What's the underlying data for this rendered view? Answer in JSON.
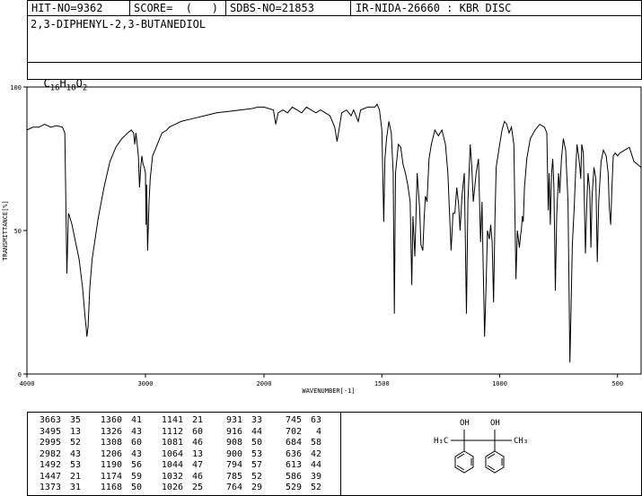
{
  "header": {
    "hit_no": "HIT-NO=9362",
    "score": "SCORE=  (   )",
    "sdbs_no": "SDBS-NO=21853",
    "ir_id": "IR-NIDA-26660 : KBR DISC",
    "compound_name": "2,3-DIPHENYL-2,3-BUTANEDIOL",
    "formula": {
      "c": "C",
      "c_n": "16",
      "h": "H",
      "h_n": "18",
      "o": "O",
      "o_n": "2"
    }
  },
  "chart_data": {
    "type": "line",
    "xlabel": "WAVENUMBER[-1]",
    "ylabel": "TRANSMITTANCE[%]",
    "xlim": [
      4000,
      400
    ],
    "ylim": [
      0,
      100
    ],
    "x_ticks": [
      "4000",
      "3000",
      "2000",
      "1500",
      "1000",
      "500"
    ],
    "y_ticks": [
      "100",
      "50",
      "0"
    ],
    "series": [
      {
        "points": [
          [
            4000,
            85
          ],
          [
            3950,
            86
          ],
          [
            3900,
            86
          ],
          [
            3850,
            87
          ],
          [
            3800,
            86
          ],
          [
            3750,
            86.5
          ],
          [
            3700,
            86
          ],
          [
            3680,
            84
          ],
          [
            3663,
            35
          ],
          [
            3650,
            56
          ],
          [
            3640,
            55
          ],
          [
            3620,
            52
          ],
          [
            3600,
            48
          ],
          [
            3560,
            40
          ],
          [
            3530,
            30
          ],
          [
            3510,
            20
          ],
          [
            3500,
            16
          ],
          [
            3495,
            13
          ],
          [
            3485,
            16
          ],
          [
            3470,
            30
          ],
          [
            3450,
            40
          ],
          [
            3400,
            54
          ],
          [
            3350,
            65
          ],
          [
            3300,
            74
          ],
          [
            3250,
            79
          ],
          [
            3200,
            82
          ],
          [
            3150,
            84
          ],
          [
            3120,
            85
          ],
          [
            3100,
            84
          ],
          [
            3090,
            80
          ],
          [
            3080,
            84
          ],
          [
            3070,
            80
          ],
          [
            3060,
            76
          ],
          [
            3050,
            65
          ],
          [
            3040,
            72
          ],
          [
            3030,
            76
          ],
          [
            3020,
            73
          ],
          [
            3010,
            72
          ],
          [
            3000,
            70
          ],
          [
            2995,
            52
          ],
          [
            2990,
            66
          ],
          [
            2982,
            43
          ],
          [
            2970,
            60
          ],
          [
            2960,
            68
          ],
          [
            2950,
            72
          ],
          [
            2940,
            76
          ],
          [
            2920,
            78
          ],
          [
            2900,
            80
          ],
          [
            2880,
            82
          ],
          [
            2860,
            84
          ],
          [
            2820,
            85
          ],
          [
            2800,
            86
          ],
          [
            2750,
            87
          ],
          [
            2700,
            88
          ],
          [
            2600,
            89
          ],
          [
            2500,
            90
          ],
          [
            2400,
            91
          ],
          [
            2300,
            91.5
          ],
          [
            2200,
            92
          ],
          [
            2100,
            92.5
          ],
          [
            2050,
            93
          ],
          [
            2000,
            93
          ],
          [
            1960,
            92
          ],
          [
            1950,
            87
          ],
          [
            1940,
            91
          ],
          [
            1920,
            92
          ],
          [
            1900,
            91
          ],
          [
            1880,
            93
          ],
          [
            1860,
            92
          ],
          [
            1840,
            91
          ],
          [
            1820,
            93
          ],
          [
            1800,
            92
          ],
          [
            1780,
            91
          ],
          [
            1760,
            92
          ],
          [
            1740,
            91
          ],
          [
            1720,
            90
          ],
          [
            1700,
            86
          ],
          [
            1690,
            81
          ],
          [
            1680,
            86
          ],
          [
            1670,
            91
          ],
          [
            1650,
            92
          ],
          [
            1630,
            90
          ],
          [
            1620,
            92
          ],
          [
            1610,
            90
          ],
          [
            1600,
            88
          ],
          [
            1590,
            92
          ],
          [
            1560,
            93
          ],
          [
            1530,
            93
          ],
          [
            1520,
            94
          ],
          [
            1510,
            92
          ],
          [
            1500,
            85
          ],
          [
            1492,
            53
          ],
          [
            1487,
            75
          ],
          [
            1480,
            82
          ],
          [
            1470,
            88
          ],
          [
            1460,
            84
          ],
          [
            1452,
            70
          ],
          [
            1447,
            21
          ],
          [
            1442,
            70
          ],
          [
            1430,
            80
          ],
          [
            1420,
            79
          ],
          [
            1410,
            73
          ],
          [
            1400,
            70
          ],
          [
            1390,
            66
          ],
          [
            1380,
            60
          ],
          [
            1373,
            31
          ],
          [
            1368,
            55
          ],
          [
            1360,
            41
          ],
          [
            1355,
            55
          ],
          [
            1350,
            70
          ],
          [
            1340,
            58
          ],
          [
            1334,
            45
          ],
          [
            1326,
            43
          ],
          [
            1320,
            55
          ],
          [
            1315,
            62
          ],
          [
            1308,
            60
          ],
          [
            1300,
            75
          ],
          [
            1290,
            80
          ],
          [
            1275,
            85
          ],
          [
            1260,
            83
          ],
          [
            1245,
            85
          ],
          [
            1230,
            80
          ],
          [
            1220,
            70
          ],
          [
            1206,
            43
          ],
          [
            1198,
            56
          ],
          [
            1190,
            56
          ],
          [
            1182,
            65
          ],
          [
            1174,
            59
          ],
          [
            1168,
            50
          ],
          [
            1160,
            62
          ],
          [
            1150,
            70
          ],
          [
            1141,
            21
          ],
          [
            1135,
            60
          ],
          [
            1125,
            80
          ],
          [
            1118,
            72
          ],
          [
            1112,
            60
          ],
          [
            1100,
            70
          ],
          [
            1090,
            75
          ],
          [
            1081,
            46
          ],
          [
            1075,
            60
          ],
          [
            1070,
            38
          ],
          [
            1064,
            13
          ],
          [
            1058,
            30
          ],
          [
            1052,
            50
          ],
          [
            1044,
            47
          ],
          [
            1038,
            52
          ],
          [
            1032,
            46
          ],
          [
            1026,
            25
          ],
          [
            1020,
            55
          ],
          [
            1015,
            72
          ],
          [
            1000,
            80
          ],
          [
            990,
            85
          ],
          [
            980,
            88
          ],
          [
            970,
            87
          ],
          [
            960,
            84
          ],
          [
            950,
            86
          ],
          [
            940,
            80
          ],
          [
            931,
            33
          ],
          [
            925,
            50
          ],
          [
            916,
            44
          ],
          [
            912,
            48
          ],
          [
            908,
            50
          ],
          [
            904,
            55
          ],
          [
            900,
            53
          ],
          [
            895,
            65
          ],
          [
            885,
            75
          ],
          [
            870,
            82
          ],
          [
            850,
            85
          ],
          [
            830,
            87
          ],
          [
            810,
            86
          ],
          [
            800,
            84
          ],
          [
            794,
            57
          ],
          [
            790,
            70
          ],
          [
            785,
            52
          ],
          [
            780,
            70
          ],
          [
            775,
            75
          ],
          [
            770,
            65
          ],
          [
            764,
            29
          ],
          [
            758,
            55
          ],
          [
            750,
            70
          ],
          [
            745,
            63
          ],
          [
            738,
            75
          ],
          [
            730,
            82
          ],
          [
            720,
            78
          ],
          [
            710,
            60
          ],
          [
            702,
            4
          ],
          [
            698,
            20
          ],
          [
            692,
            45
          ],
          [
            684,
            58
          ],
          [
            678,
            70
          ],
          [
            672,
            80
          ],
          [
            665,
            76
          ],
          [
            660,
            72
          ],
          [
            656,
            68
          ],
          [
            652,
            80
          ],
          [
            645,
            77
          ],
          [
            636,
            42
          ],
          [
            630,
            60
          ],
          [
            625,
            70
          ],
          [
            618,
            64
          ],
          [
            613,
            44
          ],
          [
            608,
            62
          ],
          [
            600,
            72
          ],
          [
            592,
            68
          ],
          [
            586,
            39
          ],
          [
            580,
            60
          ],
          [
            570,
            74
          ],
          [
            560,
            78
          ],
          [
            548,
            76
          ],
          [
            540,
            70
          ],
          [
            535,
            58
          ],
          [
            529,
            52
          ],
          [
            524,
            65
          ],
          [
            518,
            76
          ],
          [
            510,
            77
          ],
          [
            500,
            76
          ],
          [
            490,
            77
          ],
          [
            470,
            78
          ],
          [
            450,
            79
          ],
          [
            430,
            74
          ],
          [
            415,
            73
          ],
          [
            400,
            72
          ]
        ]
      }
    ]
  },
  "peak_table": {
    "columns": [
      [
        [
          "3663",
          "35"
        ],
        [
          "3495",
          "13"
        ],
        [
          "2995",
          "52"
        ],
        [
          "2982",
          "43"
        ],
        [
          "1492",
          "53"
        ],
        [
          "1447",
          "21"
        ],
        [
          "1373",
          "31"
        ]
      ],
      [
        [
          "1360",
          "41"
        ],
        [
          "1326",
          "43"
        ],
        [
          "1308",
          "60"
        ],
        [
          "1206",
          "43"
        ],
        [
          "1190",
          "56"
        ],
        [
          "1174",
          "59"
        ],
        [
          "1168",
          "50"
        ]
      ],
      [
        [
          "1141",
          "21"
        ],
        [
          "1112",
          "60"
        ],
        [
          "1081",
          "46"
        ],
        [
          "1064",
          "13"
        ],
        [
          "1044",
          "47"
        ],
        [
          "1032",
          "46"
        ],
        [
          "1026",
          "25"
        ]
      ],
      [
        [
          "931",
          "33"
        ],
        [
          "916",
          "44"
        ],
        [
          "908",
          "50"
        ],
        [
          "900",
          "53"
        ],
        [
          "794",
          "57"
        ],
        [
          "785",
          "52"
        ],
        [
          "764",
          "29"
        ]
      ],
      [
        [
          "745",
          "63"
        ],
        [
          "702",
          "4"
        ],
        [
          "684",
          "58"
        ],
        [
          "636",
          "42"
        ],
        [
          "613",
          "44"
        ],
        [
          "586",
          "39"
        ],
        [
          "529",
          "52"
        ]
      ]
    ]
  },
  "structure": {
    "labels": {
      "oh1": "OH",
      "oh2": "OH",
      "ch3_left": "H₃C",
      "ch3_right": "CH₃"
    }
  }
}
